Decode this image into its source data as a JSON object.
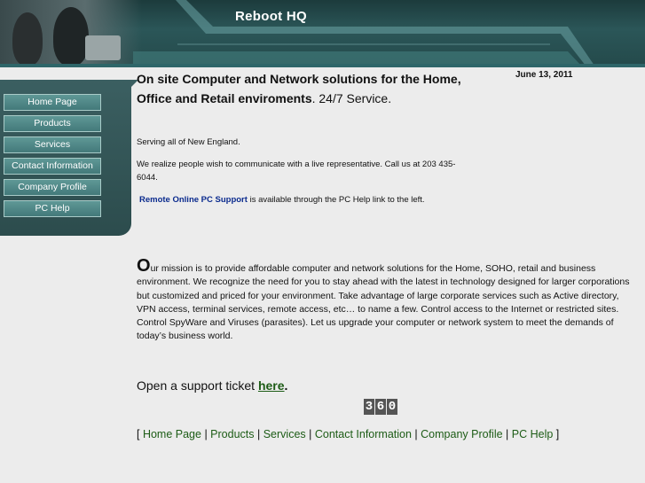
{
  "header": {
    "site_title": "Reboot HQ"
  },
  "nav": {
    "items": [
      {
        "label": "Home Page"
      },
      {
        "label": "Products"
      },
      {
        "label": "Services"
      },
      {
        "label": "Contact Information"
      },
      {
        "label": "Company Profile"
      },
      {
        "label": "PC Help"
      }
    ]
  },
  "main": {
    "date": "June 13, 2011",
    "lede_bold": "On site Computer and Network solutions for the Home, Office and Retail enviroments",
    "lede_rest": ".   24/7 Service.",
    "serving": "Serving all of New England.",
    "call": "We realize people wish to communicate with a live representative. Call us at  203 435-6044.",
    "remote_link": "Remote Online PC Support",
    "remote_rest": " is available through the PC Help link to the left.",
    "mission_cap": "O",
    "mission_text": "ur mission is to provide affordable computer and network  solutions for the Home, SOHO, retail and business environment. We recognize the need for you to stay ahead with the latest in technology designed for larger corporations but customized and priced for your environment. Take advantage of large corporate services such as Active directory, VPN access, terminal services, remote access, etc… to name a few. Control access to the Internet or restricted sites. Control SpyWare and Viruses (parasites). Let us upgrade your computer or network system to meet the demands of today’s business world.",
    "ticket_text": "Open a support ticket ",
    "ticket_link": "here",
    "ticket_end": ".",
    "counter_digits": [
      "3",
      "6",
      "0"
    ]
  },
  "footer": {
    "open": "[ ",
    "sep": " | ",
    "close": " ]",
    "links": [
      "Home Page",
      "Products",
      "Services",
      "Contact Information",
      "Company Profile",
      "PC Help"
    ]
  },
  "colors": {
    "accent": "#2b5658",
    "link": "#1d5c16",
    "nav_button": "#4f8786"
  }
}
